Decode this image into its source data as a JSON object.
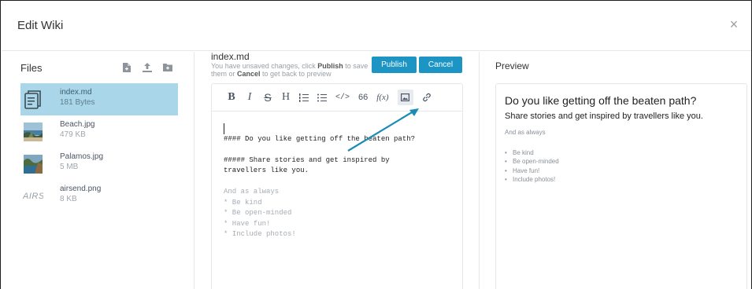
{
  "dialog": {
    "title": "Edit Wiki",
    "close_symbol": "×"
  },
  "files": {
    "title": "Files",
    "actions": [
      {
        "icon": "new-file-icon"
      },
      {
        "icon": "upload-icon"
      },
      {
        "icon": "new-folder-icon"
      }
    ],
    "items": [
      {
        "name": "index.md",
        "size": "181 Bytes",
        "type": "document",
        "selected": true
      },
      {
        "name": "Beach.jpg",
        "size": "479 KB",
        "type": "image"
      },
      {
        "name": "Palamos.jpg",
        "size": "5 MB",
        "type": "image"
      },
      {
        "name": "airsend.png",
        "size": "8 KB",
        "type": "logo",
        "thumb_text": "AIRS"
      }
    ]
  },
  "editor": {
    "doc_name": "index.md",
    "hint_pre": "You have unsaved changes, click ",
    "hint_publish": "Publish",
    "hint_mid": " to save them or ",
    "hint_cancel": "Cancel",
    "hint_post": " to get back to preview",
    "publish_label": "Publish",
    "cancel_label": "Cancel",
    "toolbar": [
      {
        "id": "bold",
        "glyph": "B",
        "icon": "bold-icon"
      },
      {
        "id": "italic",
        "glyph": "I",
        "icon": "italic-icon"
      },
      {
        "id": "strike",
        "glyph": "S",
        "icon": "strikethrough-icon"
      },
      {
        "id": "heading",
        "glyph": "H",
        "icon": "heading-icon"
      },
      {
        "id": "ordered-list",
        "glyph": "",
        "icon": "ordered-list-icon"
      },
      {
        "id": "bullet-list",
        "glyph": "",
        "icon": "bullet-list-icon"
      },
      {
        "id": "code",
        "glyph": "</>",
        "icon": "code-icon"
      },
      {
        "id": "quote",
        "glyph": "66",
        "icon": "quote-icon"
      },
      {
        "id": "formula",
        "glyph": "f(x)",
        "icon": "formula-icon"
      },
      {
        "id": "image",
        "glyph": "",
        "icon": "image-icon",
        "active": true
      },
      {
        "id": "link",
        "glyph": "",
        "icon": "link-icon"
      }
    ],
    "lines": [
      {
        "text": "",
        "dim": false
      },
      {
        "text": "#### Do you like getting off the beaten path?",
        "dim": false
      },
      {
        "text": "",
        "dim": false
      },
      {
        "text": "##### Share stories and get inspired by",
        "dim": false
      },
      {
        "text": "travellers like you.",
        "dim": false
      },
      {
        "text": "",
        "dim": false
      },
      {
        "text": "And as always",
        "dim": true
      },
      {
        "text": "* Be kind",
        "dim": true
      },
      {
        "text": "* Be open-minded",
        "dim": true
      },
      {
        "text": "* Have fun!",
        "dim": true
      },
      {
        "text": "* Include photos!",
        "dim": true
      }
    ]
  },
  "preview": {
    "title": "Preview",
    "h1": "Do you like getting off the beaten path?",
    "h2": "Share stories and get inspired by travellers like you.",
    "para": "And as always",
    "list": [
      "Be kind",
      "Be open-minded",
      "Have fun!",
      "Include photos!"
    ]
  },
  "colors": {
    "accent": "#1c95c4",
    "selected_row": "#a9d6e8",
    "arrow": "#1a8cb5"
  }
}
